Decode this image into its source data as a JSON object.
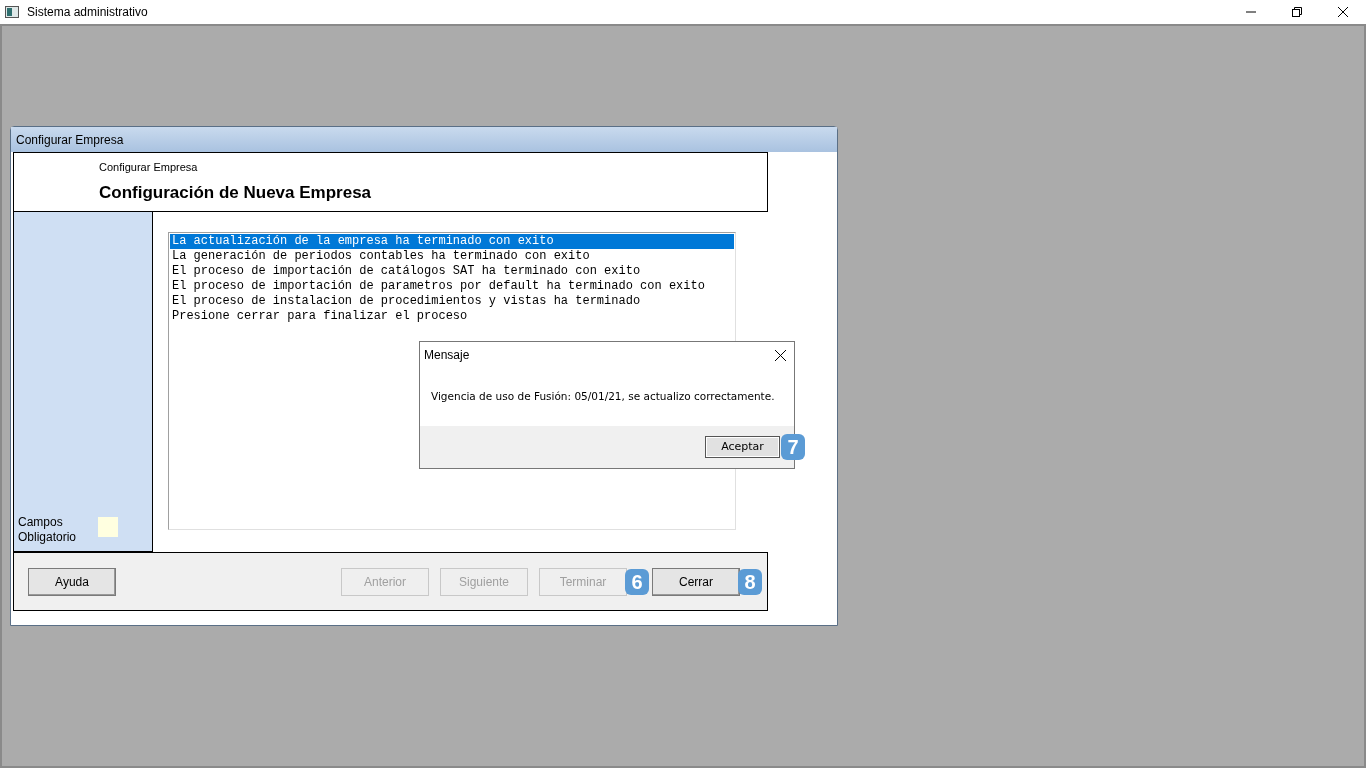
{
  "window": {
    "title": "Sistema administrativo"
  },
  "wizard": {
    "title": "Configurar Empresa",
    "subtitle": "Configurar Empresa",
    "heading": "Configuración de Nueva Empresa",
    "required_legend": "Campos Obligatorio",
    "log": [
      {
        "text": "La actualización de la empresa ha terminado con exito",
        "selected": true
      },
      {
        "text": "La generación de periodos contables ha terminado con exito",
        "selected": false
      },
      {
        "text": "El proceso de importación de catálogos SAT ha terminado con exito",
        "selected": false
      },
      {
        "text": "El proceso de importación de parametros por default ha terminado con exito",
        "selected": false
      },
      {
        "text": "El proceso de instalacion de procedimientos y vistas ha terminado",
        "selected": false
      },
      {
        "text": "Presione cerrar para finalizar el proceso",
        "selected": false
      }
    ],
    "buttons": [
      {
        "label": "Ayuda",
        "disabled": false
      },
      {
        "label": "Anterior",
        "disabled": true
      },
      {
        "label": "Siguiente",
        "disabled": true
      },
      {
        "label": "Terminar",
        "disabled": true,
        "badge": "6"
      },
      {
        "label": "Cerrar",
        "disabled": false,
        "badge": "8"
      }
    ]
  },
  "message": {
    "title": "Mensaje",
    "text": "Vigencia de uso de Fusión: 05/01/21, se actualizo correctamente.",
    "button": "Aceptar",
    "badge": "7"
  }
}
